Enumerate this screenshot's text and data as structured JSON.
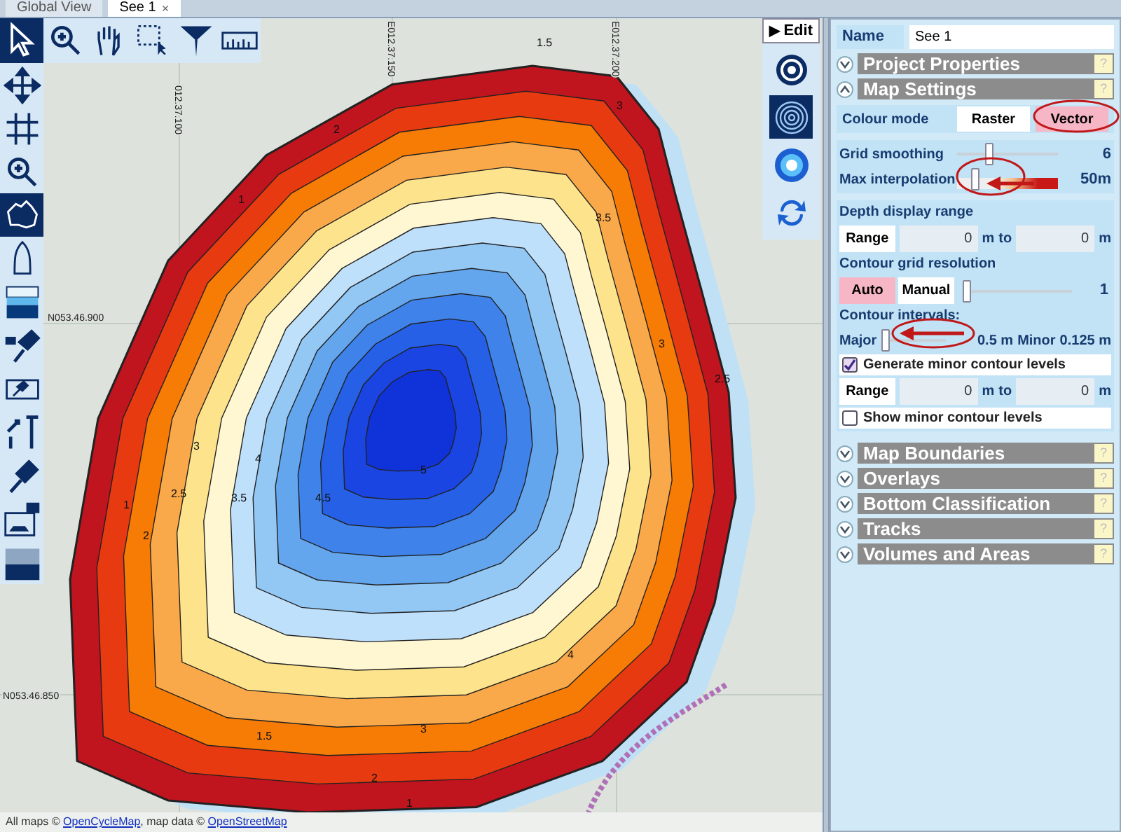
{
  "tabs": [
    {
      "label": "Global View",
      "selected": false
    },
    {
      "label": "See 1",
      "selected": true,
      "close": "×"
    }
  ],
  "top_tools": [
    {
      "kind": "pointer",
      "selected": true
    },
    {
      "kind": "zoom",
      "selected": false
    },
    {
      "kind": "hand",
      "selected": false
    },
    {
      "kind": "select",
      "selected": false
    },
    {
      "kind": "funnel",
      "selected": false
    },
    {
      "kind": "ruler",
      "selected": false
    }
  ],
  "side_tools": [
    {
      "kind": "move",
      "selected": false
    },
    {
      "kind": "grid",
      "selected": false
    },
    {
      "kind": "zoom",
      "selected": false
    },
    {
      "kind": "map",
      "selected": true
    },
    {
      "kind": "boat",
      "selected": false
    },
    {
      "kind": "layers",
      "selected": false
    },
    {
      "kind": "pin-lock",
      "selected": false
    },
    {
      "kind": "pin-box",
      "selected": false
    },
    {
      "kind": "pin-resize",
      "selected": false
    },
    {
      "kind": "pin",
      "selected": false
    },
    {
      "kind": "boat-image",
      "selected": false
    },
    {
      "kind": "dither",
      "selected": false
    }
  ],
  "map": {
    "grid_labels": [
      "012.37.100",
      "E012.37.150",
      "E012.37.200",
      "N053.46.900",
      "N053.46.850"
    ],
    "contour_labels": [
      "1.5",
      "2",
      "1",
      "3",
      "1",
      "2",
      "2.5",
      "3",
      "3.5",
      "4",
      "4.5",
      "5",
      "4",
      "3",
      "1.5",
      "2",
      "1",
      "2.5",
      "3",
      "3.5"
    ],
    "attribution": {
      "prefix": "All maps ©",
      "link1": "OpenCycleMap",
      "middle": ", map data ©",
      "link2": "OpenStreetMap"
    }
  },
  "edit_button": {
    "icon": "▶",
    "label": "Edit"
  },
  "view_modes": [
    {
      "selected": false
    },
    {
      "selected": true
    },
    {
      "selected": false
    },
    {
      "selected": false
    }
  ],
  "panel": {
    "name": {
      "label": "Name",
      "value": "See 1"
    },
    "sections_before": [
      {
        "title": "Project Properties",
        "expanded": false,
        "help": "?"
      },
      {
        "title": "Map Settings",
        "expanded": true,
        "help": "?"
      }
    ],
    "colour_mode": {
      "label": "Colour mode",
      "options": [
        {
          "label": "Raster",
          "selected": false
        },
        {
          "label": "Vector",
          "selected": true
        }
      ]
    },
    "sliders": [
      {
        "label": "Grid smoothing",
        "kind": "plain",
        "level": 0.3,
        "value": "6"
      },
      {
        "label": "Max interpolation",
        "kind": "gradient",
        "level": 0.15,
        "value": "50m"
      }
    ],
    "depth_range": {
      "label": "Depth display range",
      "button": "Range",
      "from": "0",
      "unit1": "m",
      "to": "to",
      "until": "0",
      "unit2": "m"
    },
    "grid_resolution": {
      "label": "Contour grid resolution",
      "options": [
        {
          "label": "Auto",
          "selected": true
        },
        {
          "label": "Manual",
          "selected": false
        }
      ],
      "level": 0,
      "value": "1"
    },
    "intervals": {
      "label": "Contour intervals:",
      "major": "Major",
      "level": 0,
      "major_value": "0.5 m",
      "minor": "Minor",
      "minor_value": "0.125 m"
    },
    "generate_minor": {
      "label": "Generate minor contour levels",
      "checked": true
    },
    "minor_range": {
      "button": "Range",
      "from": "0",
      "unit1": "m",
      "to": "to",
      "until": "0",
      "unit2": "m"
    },
    "show_minor": {
      "label": "Show minor contour levels",
      "checked": false
    },
    "sections_after": [
      {
        "title": "Map Boundaries",
        "expanded": false,
        "help": "?"
      },
      {
        "title": "Overlays",
        "expanded": false,
        "help": "?"
      },
      {
        "title": "Bottom Classification",
        "expanded": false,
        "help": "?"
      },
      {
        "title": "Tracks",
        "expanded": false,
        "help": "?"
      },
      {
        "title": "Volumes and Areas",
        "expanded": false,
        "help": "?"
      }
    ]
  }
}
